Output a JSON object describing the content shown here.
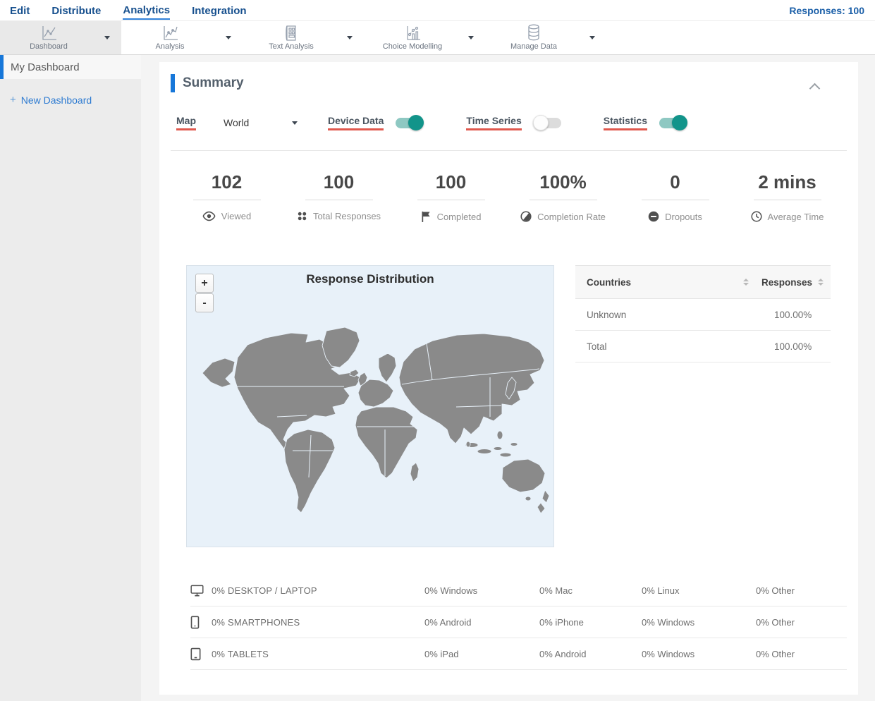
{
  "nav": {
    "items": [
      {
        "label": "Edit"
      },
      {
        "label": "Distribute"
      },
      {
        "label": "Analytics"
      },
      {
        "label": "Integration"
      }
    ],
    "active": "Analytics",
    "responses_label": "Responses: 100"
  },
  "toolbar": {
    "items": [
      {
        "label": "Dashboard",
        "icon": "line-chart-icon",
        "selected": true
      },
      {
        "label": "Analysis",
        "icon": "line-chart-dots-icon",
        "selected": false
      },
      {
        "label": "Text Analysis",
        "icon": "document-grid-icon",
        "selected": false
      },
      {
        "label": "Choice Modelling",
        "icon": "scatter-chart-icon",
        "selected": false
      },
      {
        "label": "Manage Data",
        "icon": "database-icon",
        "selected": false
      }
    ]
  },
  "sidebar": {
    "items": [
      {
        "label": "My Dashboard",
        "active": true
      }
    ],
    "new_dashboard": {
      "plus": "+",
      "label": "New Dashboard"
    }
  },
  "summary": {
    "title": "Summary",
    "controls": {
      "map_label": "Map",
      "map_value": "World",
      "device_data_label": "Device Data",
      "device_data_on": true,
      "time_series_label": "Time Series",
      "time_series_on": false,
      "statistics_label": "Statistics",
      "statistics_on": true
    },
    "stats": [
      {
        "value": "102",
        "label": "Viewed",
        "icon": "eye-icon"
      },
      {
        "value": "100",
        "label": "Total Responses",
        "icon": "dots-grid-icon"
      },
      {
        "value": "100",
        "label": "Completed",
        "icon": "flag-icon"
      },
      {
        "value": "100%",
        "label": "Completion Rate",
        "icon": "contrast-circle-icon"
      },
      {
        "value": "0",
        "label": "Dropouts",
        "icon": "minus-circle-icon"
      },
      {
        "value": "2 mins",
        "label": "Average Time",
        "icon": "clock-icon"
      }
    ],
    "map": {
      "title": "Response Distribution",
      "zoom_in": "+",
      "zoom_out": "-"
    },
    "countries_table": {
      "headers": [
        "Countries",
        "Responses"
      ],
      "rows": [
        {
          "country": "Unknown",
          "responses": "100.00%"
        },
        {
          "country": "Total",
          "responses": "100.00%"
        }
      ]
    },
    "device_table": {
      "rows": [
        {
          "icon": "desktop-icon",
          "label": "0% DESKTOP / LAPTOP",
          "values": [
            "0% Windows",
            "0% Mac",
            "0% Linux",
            "0% Other"
          ]
        },
        {
          "icon": "smartphone-icon",
          "label": "0% SMARTPHONES",
          "values": [
            "0% Android",
            "0% iPhone",
            "0% Windows",
            "0% Other"
          ]
        },
        {
          "icon": "tablet-icon",
          "label": "0% TABLETS",
          "values": [
            "0% iPad",
            "0% Android",
            "0% Windows",
            "0% Other"
          ]
        }
      ]
    }
  },
  "colors": {
    "nav_blue": "#17508e",
    "accent_blue": "#1777d9",
    "link_blue": "#2e7bd1",
    "underline_red": "#e0584d",
    "toggle_on_knob": "#12948a",
    "toggle_on_track": "#8ec8c2",
    "map_background": "#e8f1f9",
    "map_land": "#8a8a8a"
  }
}
